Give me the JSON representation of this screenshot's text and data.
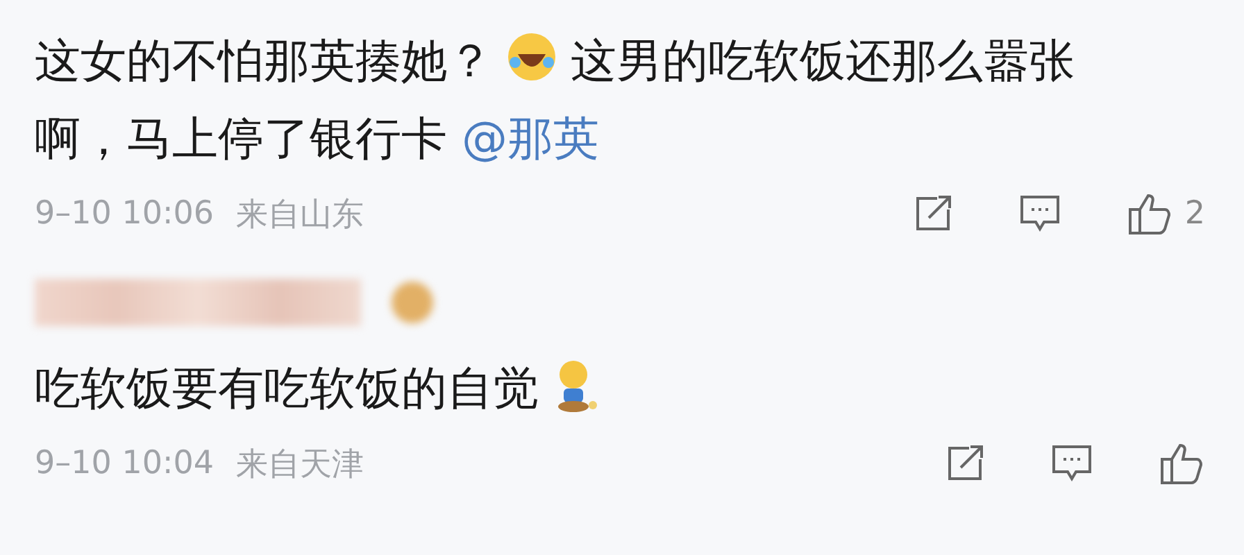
{
  "comments": [
    {
      "segments": [
        {
          "kind": "text",
          "text": "这女的不怕那英揍她？"
        },
        {
          "kind": "laugh-emoji"
        },
        {
          "kind": "text",
          "text": "这男的吃软饭还那么嚣张啊，马上停了银行卡 "
        },
        {
          "kind": "mention",
          "text": "@那英"
        }
      ],
      "time": "9–10 10:06",
      "location": "来自山东",
      "likes": "2"
    },
    {
      "author": {
        "kind": "blurred"
      },
      "segments": [
        {
          "kind": "text",
          "text": "吃软饭要有吃软饭的自觉"
        },
        {
          "kind": "kneel-emoji"
        }
      ],
      "time": "9–10 10:04",
      "location": "来自天津"
    }
  ]
}
